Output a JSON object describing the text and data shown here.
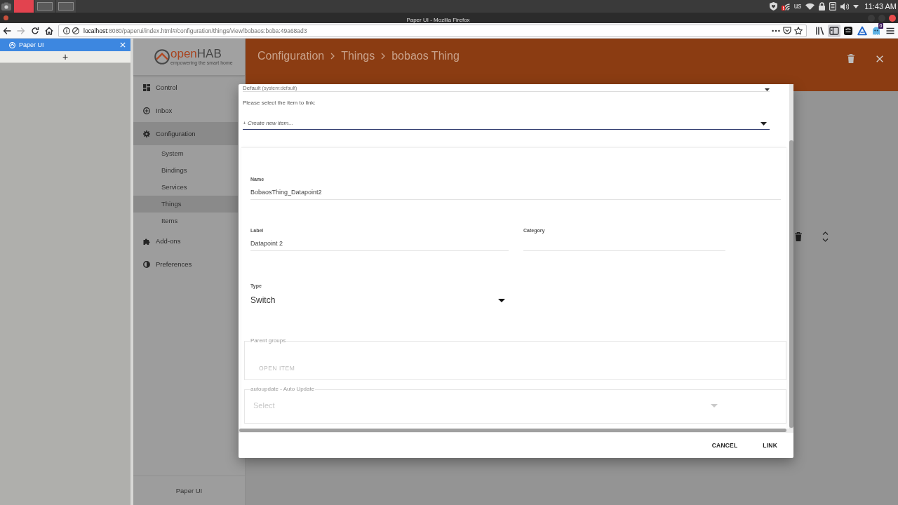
{
  "os_panel": {
    "taskbar": [
      {
        "selected": true
      },
      {
        "selected": false
      },
      {
        "selected": false
      }
    ],
    "keyboard_layout": "us",
    "clock": "11:43 AM"
  },
  "window": {
    "title": "Paper UI - Mozilla Firefox"
  },
  "toolbar": {
    "nav_buttons": [
      {
        "kind": "back",
        "disabled": false
      },
      {
        "kind": "forward",
        "disabled": true
      },
      {
        "kind": "reload",
        "disabled": false
      },
      {
        "kind": "home",
        "disabled": false
      }
    ],
    "url": {
      "host": "localhost",
      "rest": ":8080/paperui/index.html#/configuration/things/view/bobaos:boba:49a68ad3"
    },
    "tools": [
      {
        "kind": "library",
        "active": false
      },
      {
        "kind": "sidebar",
        "active": true
      },
      {
        "kind": "panel",
        "active": false
      },
      {
        "kind": "triangle",
        "active": false
      },
      {
        "kind": "ghost",
        "active": false,
        "badge": "0"
      },
      {
        "kind": "menu",
        "active": false
      }
    ]
  },
  "browser_sidebar": {
    "tab": {
      "title": "Paper UI"
    },
    "new_tab": "+"
  },
  "app": {
    "logo": {
      "parts": [
        "open",
        "HAB"
      ],
      "tagline": "empowering the smart home"
    },
    "nav": [
      {
        "label": "Control",
        "selected": false
      },
      {
        "label": "Inbox",
        "selected": false
      },
      {
        "label": "Configuration",
        "selected": true,
        "children": [
          {
            "label": "System",
            "selected": false
          },
          {
            "label": "Bindings",
            "selected": false
          },
          {
            "label": "Services",
            "selected": false
          },
          {
            "label": "Things",
            "selected": true
          },
          {
            "label": "Items",
            "selected": false
          }
        ]
      },
      {
        "label": "Add-ons",
        "selected": false
      },
      {
        "label": "Preferences",
        "selected": false
      }
    ],
    "footer": "Paper UI",
    "breadcrumb": [
      "Configuration",
      "Things",
      "bobaos Thing"
    ]
  },
  "dialog": {
    "profile": {
      "value": "Default",
      "hint": "(system:default)"
    },
    "prompt": "Please select the item to link:",
    "item_select": {
      "value": "+ Create new item..."
    },
    "field_rows": [
      {
        "fields": [
          {
            "kind": "text",
            "label": "Name",
            "value": "BobaosThing_Datapoint2"
          }
        ]
      },
      {
        "fields": [
          {
            "kind": "text",
            "label": "Label",
            "value": "Datapoint 2"
          },
          {
            "kind": "text",
            "label": "Category"
          }
        ]
      },
      {
        "fields": [
          {
            "kind": "select",
            "label": "Type",
            "value": "Switch"
          }
        ]
      }
    ],
    "parent_groups": {
      "legend": "Parent groups",
      "button": {
        "label": "OPEN ITEM",
        "disabled": true
      }
    },
    "autoupdate": {
      "legend": "autoupdate - Auto Update",
      "placeholder": "Select",
      "disabled": true
    },
    "buttons": [
      {
        "label": "CANCEL"
      },
      {
        "label": "LINK"
      }
    ]
  }
}
